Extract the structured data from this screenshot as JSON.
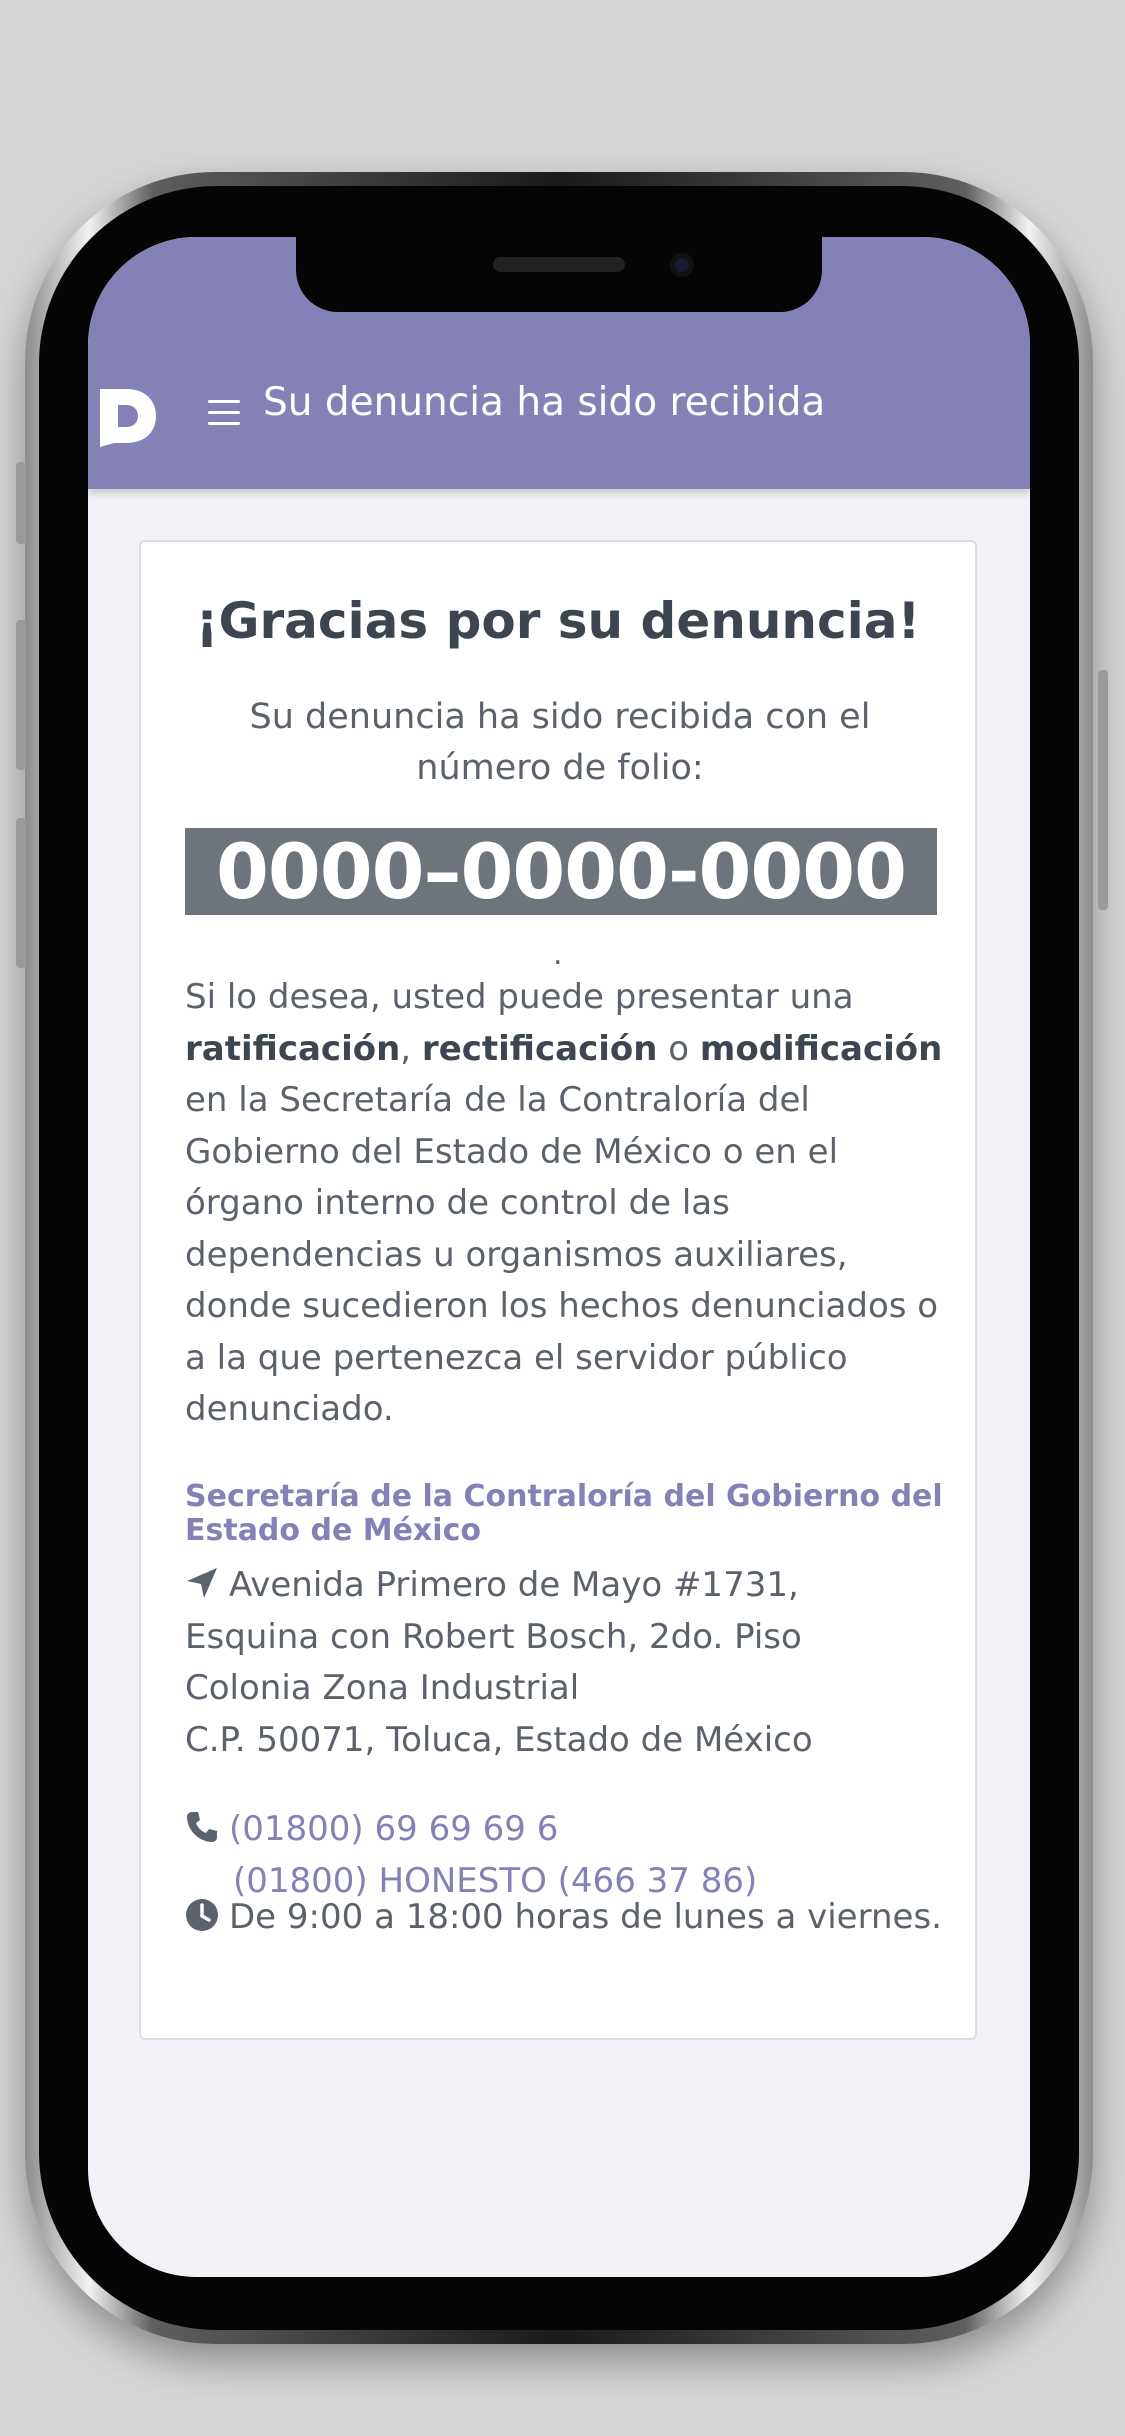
{
  "header": {
    "title": "Su denuncia ha sido recibida"
  },
  "card": {
    "title": "¡Gracias por su denuncia!",
    "subtitle": "Su denuncia ha sido recibida con el número de folio:",
    "folio": "0000–0000-0000",
    "dot": ".",
    "body": {
      "intro": "Si lo desea, usted puede presentar una ",
      "term1": "ratificación",
      "sep1": ", ",
      "term2": "rectificación",
      "sep2": " o ",
      "term3": "modificación",
      "rest": " en la Secretaría de la Contraloría del Gobierno del Estado de México o en el órgano interno de control de las dependencias u organismos auxiliares, donde sucedieron los hechos denunciados o a la que pertenezca el servidor público denunciado."
    },
    "office": {
      "title": "Secretaría de la Contraloría del Gobierno del Estado de México",
      "address_line1": "Avenida Primero de Mayo #1731,",
      "address_line2": "Esquina con Robert Bosch, 2do. Piso",
      "address_line3": "Colonia Zona Industrial",
      "address_line4": "C.P. 50071, Toluca, Estado de México",
      "phone1": "(01800) 69 69 69 6",
      "phone2": "(01800) HONESTO (466 37 86)",
      "hours": "De 9:00 a 18:00 horas de lunes a viernes."
    }
  },
  "icons": {
    "logo": "logo-icon",
    "menu": "menu-icon",
    "address": "location-arrow-icon",
    "phone": "phone-icon",
    "hours": "clock-icon"
  },
  "colors": {
    "header": "#8481b7",
    "folio_bg": "#6e747c",
    "accent": "#8481b7",
    "text": "#5b626c",
    "title": "#3d4551"
  }
}
